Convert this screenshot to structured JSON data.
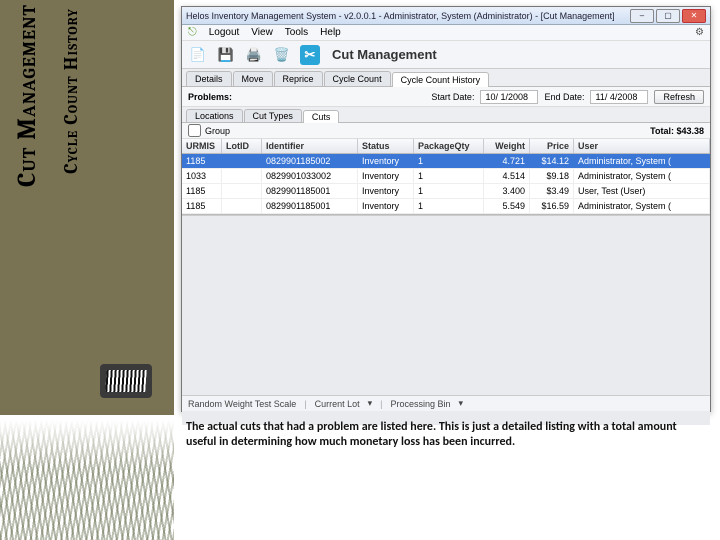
{
  "sidebar": {
    "title_main": "Cut Management",
    "title_sub": "Cycle Count History"
  },
  "window": {
    "title": "Helos Inventory Management System - v2.0.0.1 - Administrator, System (Administrator) - [Cut Management]"
  },
  "menu": {
    "logout": "Logout",
    "view": "View",
    "tools": "Tools",
    "help": "Help"
  },
  "toolbar": {
    "section_title": "Cut Management"
  },
  "main_tabs": [
    "Details",
    "Move",
    "Reprice",
    "Cycle Count",
    "Cycle Count History"
  ],
  "main_tab_active": 4,
  "problems_row": {
    "label": "Problems:",
    "start_label": "Start Date:",
    "start_value": "10/ 1/2008",
    "end_label": "End Date:",
    "end_value": "11/ 4/2008",
    "refresh": "Refresh"
  },
  "sub_tabs": [
    "Locations",
    "Cut Types",
    "Cuts"
  ],
  "sub_tab_active": 2,
  "group_row": {
    "group_label": "Group",
    "total": "Total: $43.38"
  },
  "grid": {
    "columns": [
      "URMIS",
      "LotID",
      "Identifier",
      "Status",
      "PackageQty",
      "Weight",
      "Price",
      "User"
    ],
    "rows": [
      {
        "urmis": "1185",
        "lotid": "",
        "ident": "0829901185002",
        "status": "Inventory",
        "pkg": "1",
        "weight": "4.721",
        "price": "$14.12",
        "user": "Administrator, System ("
      },
      {
        "urmis": "1033",
        "lotid": "",
        "ident": "0829901033002",
        "status": "Inventory",
        "pkg": "1",
        "weight": "4.514",
        "price": "$9.18",
        "user": "Administrator, System ("
      },
      {
        "urmis": "1185",
        "lotid": "",
        "ident": "0829901185001",
        "status": "Inventory",
        "pkg": "1",
        "weight": "3.400",
        "price": "$3.49",
        "user": "User, Test (User)"
      },
      {
        "urmis": "1185",
        "lotid": "",
        "ident": "0829901185001",
        "status": "Inventory",
        "pkg": "1",
        "weight": "5.549",
        "price": "$16.59",
        "user": "Administrator, System ("
      }
    ],
    "selected": 0
  },
  "statusbar": {
    "scale": "Random Weight Test Scale",
    "lot": "Current Lot",
    "bin": "Processing Bin"
  },
  "caption": "The actual cuts that had a problem are listed here. This is just a detailed listing with a total amount useful in determining how much monetary loss has been incurred."
}
